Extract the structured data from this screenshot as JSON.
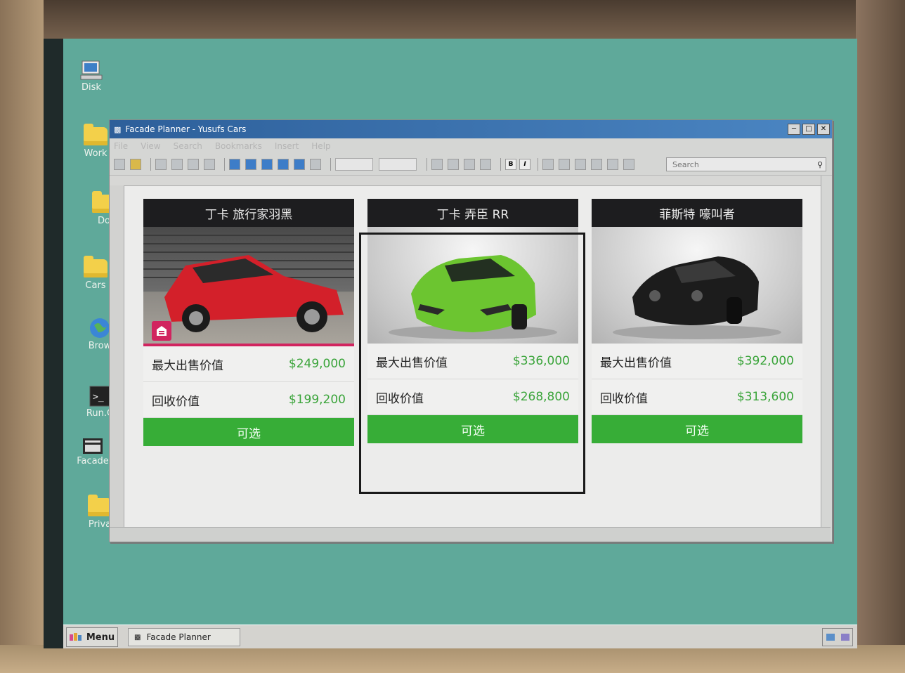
{
  "desktop": {
    "icons": [
      {
        "label": "Disk"
      },
      {
        "label": "Work"
      },
      {
        "label": "Do"
      },
      {
        "label": "Cars"
      },
      {
        "label": "Brow"
      },
      {
        "label": "Run.C"
      },
      {
        "label": "Facade"
      },
      {
        "label": "Priva"
      }
    ]
  },
  "window": {
    "title": "Facade Planner - Yusufs Cars",
    "menu": [
      "File",
      "View",
      "Search",
      "Bookmarks",
      "Insert",
      "Help"
    ],
    "search_placeholder": "Search",
    "format_bold": "B",
    "format_italic": "I"
  },
  "cards": [
    {
      "name": "丁卡 旅行家羽黑",
      "max_label": "最大出售价值",
      "max_value": "$249,000",
      "buyback_label": "回收价值",
      "buyback_value": "$199,200",
      "button": "可选",
      "car_color": "#d3202a",
      "selected": false
    },
    {
      "name": "丁卡 弄臣 RR",
      "max_label": "最大出售价值",
      "max_value": "$336,000",
      "buyback_label": "回收价值",
      "buyback_value": "$268,800",
      "button": "可选",
      "car_color": "#6cc530",
      "selected": true
    },
    {
      "name": "菲斯特 嚎叫者",
      "max_label": "最大出售价值",
      "max_value": "$392,000",
      "buyback_label": "回收价值",
      "buyback_value": "$313,600",
      "button": "可选",
      "car_color": "#1c1c1c",
      "selected": false
    }
  ],
  "taskbar": {
    "menu_label": "Menu",
    "task_label": "Facade Planner"
  },
  "colors": {
    "desktop": "#5fa99a",
    "accent_green": "#37ad37",
    "title_blue": "#2d5f9a"
  }
}
